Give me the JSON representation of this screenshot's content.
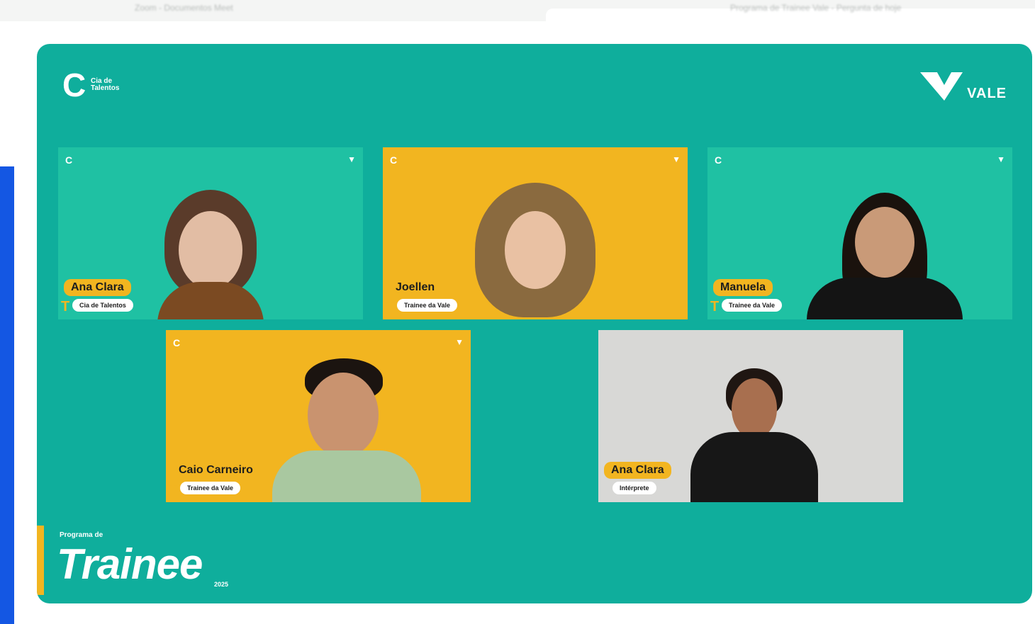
{
  "browser": {
    "left_text": "Zoom - Documentos Meet",
    "right_text": "Programa de Trainee Vale - Pergunta de hoje"
  },
  "logos": {
    "cia_top": "Cia de",
    "cia_bottom": "Talentos",
    "vale": "VALE"
  },
  "participants": [
    {
      "name": "Ana Clara",
      "role": "Cia de Talentos"
    },
    {
      "name": "Joellen",
      "role": "Trainee da Vale"
    },
    {
      "name": "Manuela",
      "role": "Trainee da Vale"
    },
    {
      "name": "Caio Carneiro",
      "role": "Trainee da Vale"
    },
    {
      "name": "Ana Clara",
      "role": "Intérprete"
    }
  ],
  "brand": {
    "small": "Programa de",
    "big": "Trainee",
    "year": "2025"
  },
  "colors": {
    "stage": "#0fae9c",
    "tile_teal": "#1fc1a3",
    "tile_yellow": "#f2b520",
    "accent_blue": "#1457e3"
  }
}
